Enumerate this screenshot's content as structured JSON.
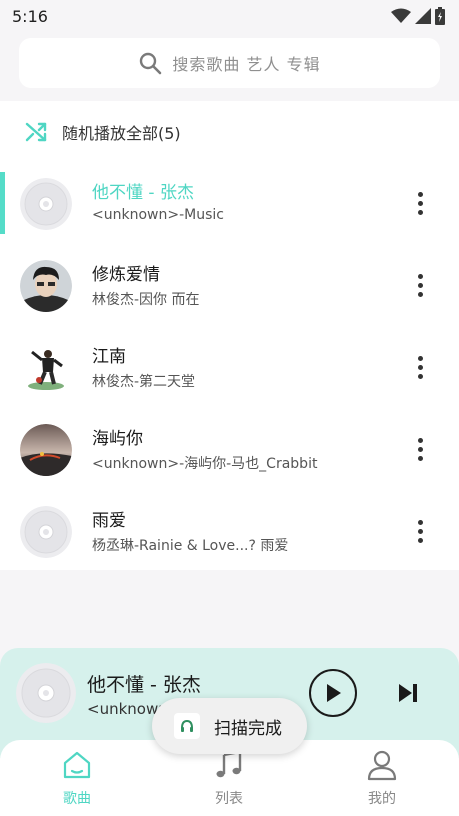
{
  "status_bar": {
    "time": "5:16"
  },
  "search": {
    "placeholder": "搜索歌曲 艺人 专辑"
  },
  "shuffle": {
    "label": "随机播放全部(5)"
  },
  "songs": [
    {
      "title": "他不懂 - 张杰",
      "subtitle": "<unknown>-Music",
      "cover": "default-disc",
      "active": true
    },
    {
      "title": "修炼爱情",
      "subtitle": "林俊杰-因你 而在",
      "cover": "artist-photo",
      "active": false
    },
    {
      "title": "江南",
      "subtitle": "林俊杰-第二天堂",
      "cover": "artist-photo",
      "active": false
    },
    {
      "title": "海屿你",
      "subtitle": "<unknown>-海屿你-马也_Crabbit",
      "cover": "album-art",
      "active": false
    },
    {
      "title": "雨爱",
      "subtitle": "杨丞琳-Rainie & Love...? 雨爱",
      "cover": "default-disc",
      "active": false
    }
  ],
  "mini_player": {
    "title": "他不懂 - 张杰",
    "subtitle": "<unknown>-Music"
  },
  "toast": {
    "text": "扫描完成"
  },
  "nav": {
    "items": [
      {
        "label": "歌曲",
        "icon": "home-icon",
        "active": true
      },
      {
        "label": "列表",
        "icon": "music-note-icon",
        "active": false
      },
      {
        "label": "我的",
        "icon": "person-icon",
        "active": false
      }
    ]
  },
  "colors": {
    "accent": "#4fd6c3",
    "player_bg": "#d6f1ec",
    "page_bg": "#f6f5f7"
  }
}
